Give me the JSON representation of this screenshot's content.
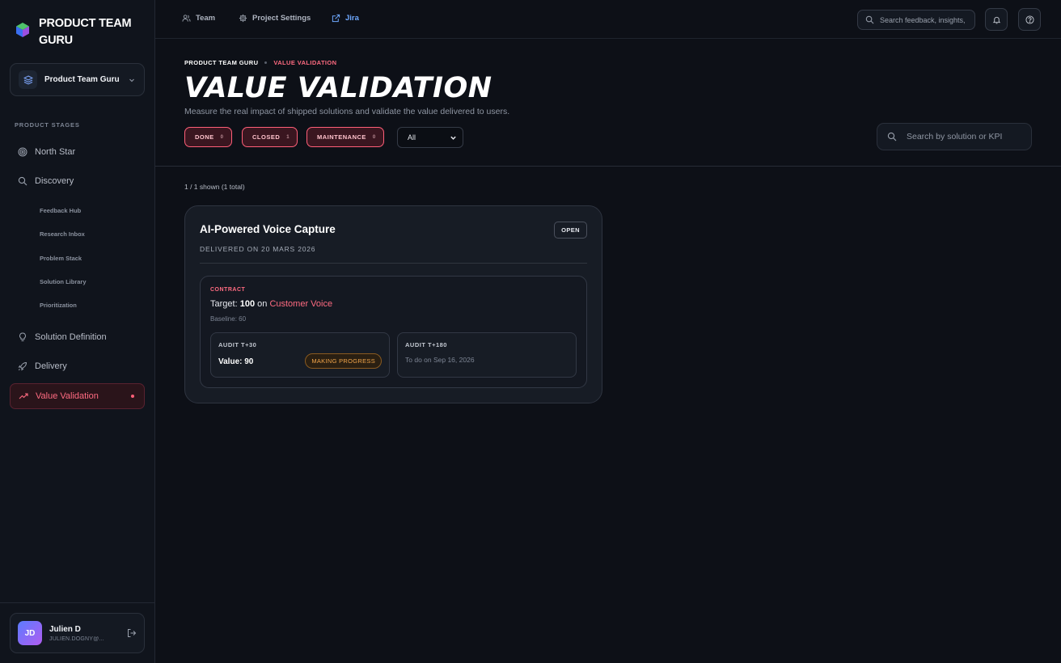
{
  "brand": {
    "name": "PRODUCT TEAM GURU"
  },
  "workspace": {
    "name": "Product Team Guru"
  },
  "sidebar": {
    "section_label": "PRODUCT STAGES",
    "items": [
      {
        "label": "North Star"
      },
      {
        "label": "Discovery"
      },
      {
        "label": "Solution Definition"
      },
      {
        "label": "Delivery"
      },
      {
        "label": "Value Validation"
      }
    ],
    "discovery_sub": [
      "Feedback Hub",
      "Research Inbox",
      "Problem Stack",
      "Solution Library",
      "Prioritization"
    ]
  },
  "user": {
    "initials": "JD",
    "name": "Julien D",
    "email": "JULIEN.DOGNY@..."
  },
  "topbar": {
    "team": "Team",
    "settings": "Project Settings",
    "jira": "Jira",
    "search_placeholder": "Search feedback, insights,"
  },
  "breadcrumb": {
    "root": "PRODUCT TEAM GURU",
    "current": "VALUE VALIDATION"
  },
  "page": {
    "title": "VALUE VALIDATION",
    "subtitle": "Measure the real impact of shipped solutions and validate the value delivered to users."
  },
  "filters": {
    "chips": [
      {
        "label": "DONE",
        "count": "0"
      },
      {
        "label": "CLOSED",
        "count": "1"
      },
      {
        "label": "MAINTENANCE",
        "count": "0"
      }
    ],
    "select_value": "All",
    "search_placeholder": "Search by solution or KPI"
  },
  "results": {
    "count_text": "1 / 1 shown (1 total)"
  },
  "card": {
    "title": "AI-Powered Voice Capture",
    "badge": "OPEN",
    "delivered": "DELIVERED ON 20 MARS 2026",
    "contract": {
      "label": "CONTRACT",
      "target_prefix": "Target:",
      "target_value": "100",
      "target_on": "on",
      "target_kpi": "Customer Voice",
      "baseline": "Baseline: 60"
    },
    "audits": [
      {
        "label": "AUDIT T+30",
        "value": "Value: 90",
        "status": "MAKING PROGRESS"
      },
      {
        "label": "AUDIT T+180",
        "todo": "To do on Sep 16, 2026"
      }
    ]
  },
  "colors": {
    "accent": "#ff6b81",
    "background": "#0d1017",
    "sidebar": "#10141c",
    "progress": "#f2a54a",
    "link": "#6ea8ff"
  }
}
